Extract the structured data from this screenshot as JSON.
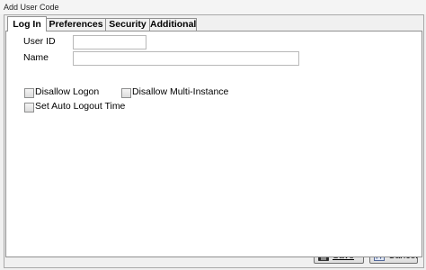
{
  "window": {
    "title": "Add User Code"
  },
  "tabs": [
    {
      "label": "Log In"
    },
    {
      "label": "Preferences"
    },
    {
      "label": "Security"
    },
    {
      "label": "Additional"
    }
  ],
  "form": {
    "user_id_label": "User ID",
    "user_id_value": "",
    "name_label": "Name",
    "name_value": "",
    "checkboxes": [
      {
        "label": "Disallow Logon",
        "checked": false
      },
      {
        "label": "Disallow Multi-Instance",
        "checked": false
      },
      {
        "label": "Set Auto Logout Time",
        "checked": false
      }
    ]
  },
  "buttons": {
    "save_label": "Save",
    "cancel_label": "Cancel"
  },
  "icons": {
    "save": "floppy-disk-icon",
    "cancel": "cancel-f7-icon"
  }
}
